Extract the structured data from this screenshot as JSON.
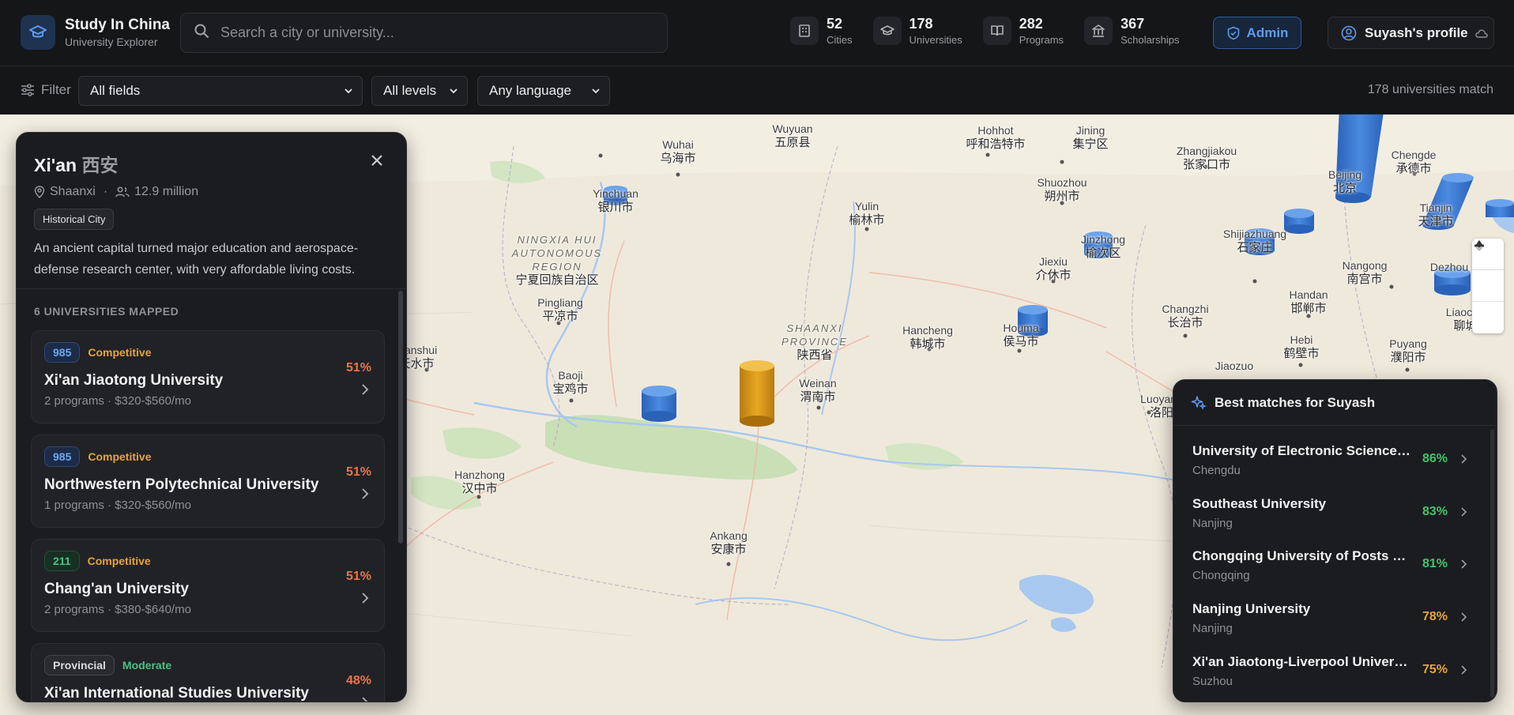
{
  "brand": {
    "title": "Study In China",
    "subtitle": "University Explorer"
  },
  "search": {
    "placeholder": "Search a city or university..."
  },
  "stats": [
    {
      "value": "52",
      "label": "Cities",
      "icon": "building-icon"
    },
    {
      "value": "178",
      "label": "Universities",
      "icon": "graduation-cap-icon"
    },
    {
      "value": "282",
      "label": "Programs",
      "icon": "book-icon"
    },
    {
      "value": "367",
      "label": "Scholarships",
      "icon": "bank-icon"
    }
  ],
  "header": {
    "admin_label": "Admin",
    "profile_label": "Suyash's profile"
  },
  "filters": {
    "label": "Filter",
    "field": "All fields",
    "level": "All levels",
    "language": "Any language",
    "match_count": "178 universities match"
  },
  "city": {
    "name": "Xi'an",
    "name_zh": "西安",
    "province": "Shaanxi",
    "population": "12.9 million",
    "tag": "Historical City",
    "description": "An ancient capital turned major education and aerospace-defense research center, with very affordable living costs.",
    "uni_heading": "6 UNIVERSITIES MAPPED",
    "universities": [
      {
        "badge": "985",
        "competition": "Competitive",
        "name": "Xi'an Jiaotong University",
        "sub": "2 programs · $320-$560/mo",
        "match": "51%"
      },
      {
        "badge": "985",
        "competition": "Competitive",
        "name": "Northwestern Polytechnical University",
        "sub": "1 programs · $320-$560/mo",
        "match": "51%"
      },
      {
        "badge": "211",
        "competition": "Competitive",
        "name": "Chang'an University",
        "sub": "2 programs · $380-$640/mo",
        "match": "51%"
      },
      {
        "badge": "Provincial",
        "competition": "Moderate",
        "name": "Xi'an International Studies University",
        "sub": "",
        "match": "48%"
      }
    ]
  },
  "matches": {
    "title": "Best matches for Suyash",
    "items": [
      {
        "name": "University of Electronic Science and Technology of China",
        "city": "Chengdu",
        "match": "86%"
      },
      {
        "name": "Southeast University",
        "city": "Nanjing",
        "match": "83%"
      },
      {
        "name": "Chongqing University of Posts & Telecommunications",
        "city": "Chongqing",
        "match": "81%"
      },
      {
        "name": "Nanjing University",
        "city": "Nanjing",
        "match": "78%"
      },
      {
        "name": "Xi'an Jiaotong-Liverpool University",
        "city": "Suzhou",
        "match": "75%"
      }
    ]
  },
  "colors": {
    "accent": "#5b9bf0",
    "gold": "#e8a33a",
    "good": "#3fc46a",
    "warn": "#e8a33a",
    "match_low": "#e8754a"
  },
  "map_labels": [
    {
      "en": "Wuhai",
      "zh": "乌海市"
    },
    {
      "en": "Yinchuan",
      "zh": "银川市"
    },
    {
      "en": "Wuyuan",
      "zh": "五原县"
    },
    {
      "en": "Hohhot",
      "zh": "呼和浩特市"
    },
    {
      "en": "Jining",
      "zh": "集宁区"
    },
    {
      "en": "Zhangjiakou",
      "zh": "张家口市"
    },
    {
      "en": "Chengde",
      "zh": "承德市"
    },
    {
      "en": "Shuozhou",
      "zh": "朔州市"
    },
    {
      "en": "Yulin",
      "zh": "榆林市"
    },
    {
      "en": "NINGXIA HUI AUTONOMOUS REGION",
      "zh": "宁夏回族自治区"
    },
    {
      "en": "Jiexiu",
      "zh": "介休市"
    },
    {
      "en": "Shijiazhuang",
      "zh": "石家庄"
    },
    {
      "en": "Nangong",
      "zh": "南宫市"
    },
    {
      "en": "Dezhou",
      "zh": ""
    },
    {
      "en": "Pingliang",
      "zh": "平凉市"
    },
    {
      "en": "SHAANXI PROVINCE",
      "zh": "陕西省"
    },
    {
      "en": "Hancheng",
      "zh": "韩城市"
    },
    {
      "en": "Houma",
      "zh": "侯马市"
    },
    {
      "en": "Changzhi",
      "zh": "长治市"
    },
    {
      "en": "Handan",
      "zh": "邯郸市"
    },
    {
      "en": "Liaocheng",
      "zh": "聊城市"
    },
    {
      "en": "Tianshui",
      "zh": "天水市"
    },
    {
      "en": "Baoji",
      "zh": "宝鸡市"
    },
    {
      "en": "Weinan",
      "zh": "渭南市"
    },
    {
      "en": "Hebi",
      "zh": "鹤壁市"
    },
    {
      "en": "Puyang",
      "zh": "濮阳市"
    },
    {
      "en": "Jiaozuo",
      "zh": ""
    },
    {
      "en": "Luoyang",
      "zh": "洛阳"
    },
    {
      "en": "Hanzhong",
      "zh": "汉中市"
    },
    {
      "en": "Ankang",
      "zh": "安康市"
    },
    {
      "en": "Beijing",
      "zh": "北京"
    },
    {
      "en": "Tianjin",
      "zh": "天津市"
    },
    {
      "en": "Jinzhong",
      "zh": "榆次区"
    }
  ]
}
